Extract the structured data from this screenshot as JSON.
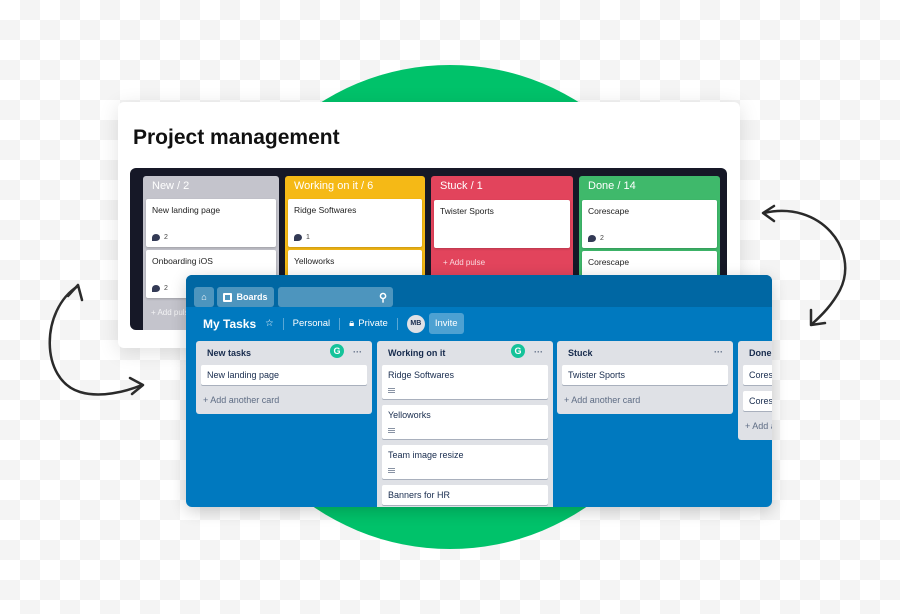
{
  "colors": {
    "circle": "#00c26a",
    "new": "#c4c4cc",
    "working": "#f5b916",
    "stuck": "#e2445c",
    "done": "#3fb96b",
    "trello_bg": "#0079bf"
  },
  "monday": {
    "title": "Project management",
    "columns": [
      {
        "header": "New / 2",
        "cards": [
          {
            "title": "New landing page",
            "comments": "2"
          },
          {
            "title": "Onboarding iOS",
            "comments": "2"
          }
        ],
        "add": "+ Add pulse"
      },
      {
        "header": "Working on it / 6",
        "cards": [
          {
            "title": "Ridge Softwares",
            "comments": "1"
          },
          {
            "title": "Yelloworks"
          }
        ]
      },
      {
        "header": "Stuck / 1",
        "cards": [
          {
            "title": "Twister Sports"
          }
        ],
        "add": "+ Add pulse"
      },
      {
        "header": "Done / 14",
        "cards": [
          {
            "title": "Corescape",
            "comments": "2"
          },
          {
            "title": "Corescape"
          }
        ]
      }
    ]
  },
  "trello": {
    "nav": {
      "boards": "Boards",
      "home_icon": "home-icon",
      "search_icon": "search-icon"
    },
    "board": {
      "title": "My Tasks",
      "team": "Personal",
      "visibility": "Private",
      "avatar": "MB",
      "invite": "Invite"
    },
    "lists": [
      {
        "title": "New tasks",
        "cards": [
          "New landing page"
        ],
        "add": "+ Add another card"
      },
      {
        "title": "Working on it",
        "cards": [
          "Ridge Softwares",
          "Yelloworks",
          "Team image resize",
          "Banners for HR"
        ]
      },
      {
        "title": "Stuck",
        "cards": [
          "Twister Sports"
        ],
        "add": "+ Add another card"
      },
      {
        "title": "Done",
        "cards": [
          "Corescape",
          "Corescape"
        ],
        "add": "+ Add another card"
      }
    ],
    "more": "···",
    "grammarly": "G"
  }
}
